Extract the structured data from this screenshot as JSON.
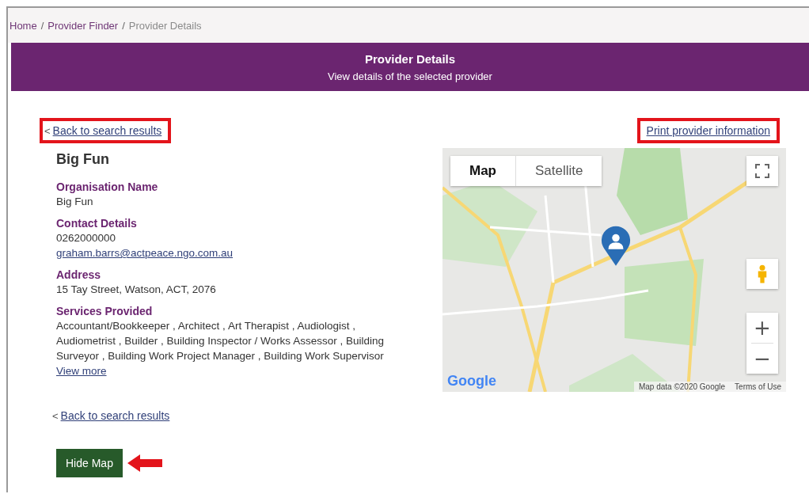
{
  "breadcrumb": {
    "separator": "/",
    "items": [
      {
        "label": "Home",
        "current": false
      },
      {
        "label": "Provider Finder",
        "current": false
      },
      {
        "label": "Provider Details",
        "current": true
      }
    ]
  },
  "header": {
    "title": "Provider Details",
    "subtitle": "View details of the selected provider"
  },
  "back_link_top": {
    "text": "Back to search results",
    "prefix": "<",
    "annotated": true
  },
  "print_link": {
    "text": "Print provider information",
    "annotated": true
  },
  "provider": {
    "name": "Big Fun",
    "sections": [
      {
        "heading": "Organisation Name",
        "lines": [
          {
            "text": "Big Fun",
            "kind": "text"
          }
        ]
      },
      {
        "heading": "Contact Details",
        "lines": [
          {
            "text": "0262000000",
            "kind": "text"
          },
          {
            "text": "graham.barrs@actpeace.ngo.com.au",
            "kind": "link"
          }
        ]
      },
      {
        "heading": "Address",
        "lines": [
          {
            "text": "15 Tay Street, Watson, ACT, 2076",
            "kind": "text"
          }
        ]
      },
      {
        "heading": "Services Provided",
        "lines": [
          {
            "text": "Accountant/Bookkeeper , Architect , Art Therapist , Audiologist , Audiometrist , Builder , Building Inspector / Works Assessor , Building Surveyor , Building Work Project Manager , Building Work Supervisor",
            "kind": "text"
          },
          {
            "text": "View more",
            "kind": "link"
          }
        ]
      }
    ]
  },
  "map": {
    "types": [
      {
        "label": "Map",
        "selected": true
      },
      {
        "label": "Satellite",
        "selected": false
      }
    ],
    "zoom_in": "+",
    "zoom_out": "−",
    "logo": "Google",
    "attribution": "Map data ©2020 Google",
    "terms": "Terms of Use"
  },
  "back_link_bottom": {
    "text": "Back to search results",
    "prefix": "<"
  },
  "hide_map_button": {
    "label": "Hide Map",
    "annotated": true
  }
}
